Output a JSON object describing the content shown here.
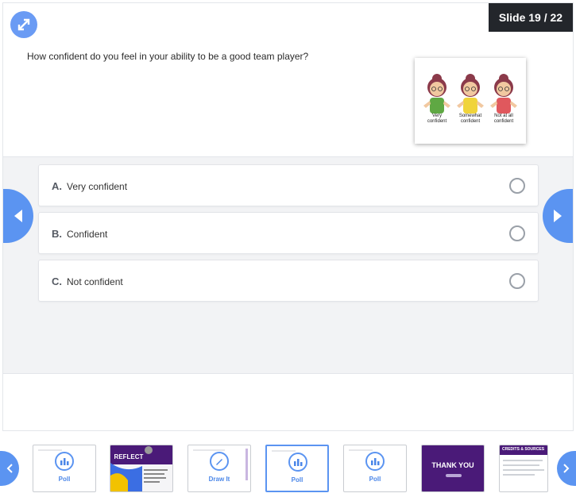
{
  "slide": {
    "counter": "Slide 19 / 22",
    "question": "How confident do you feel in your ability to be a good team player?",
    "image_labels": [
      "Very confident",
      "Somewhat confident",
      "Not at all confident"
    ]
  },
  "options": [
    {
      "letter": "A.",
      "text": "Very confident"
    },
    {
      "letter": "B.",
      "text": "Confident"
    },
    {
      "letter": "C.",
      "text": "Not confident"
    }
  ],
  "thumbnails": [
    {
      "label": "Poll"
    },
    {
      "label": "REFLECT"
    },
    {
      "label": "Draw It"
    },
    {
      "label": "Poll"
    },
    {
      "label": "Poll"
    },
    {
      "label": "THANK YOU"
    },
    {
      "label": "CREDITS & SOURCES"
    }
  ],
  "colors": {
    "accent": "#5b94f1",
    "counter_bg": "#23262b",
    "poll_text": "#4a86e8",
    "purple": "#4a1a78"
  },
  "icons": {
    "expand": "expand-arrows-icon",
    "prev": "chevron-left-icon",
    "next": "chevron-right-icon",
    "poll": "bar-chart-icon",
    "draw": "pencil-icon"
  }
}
